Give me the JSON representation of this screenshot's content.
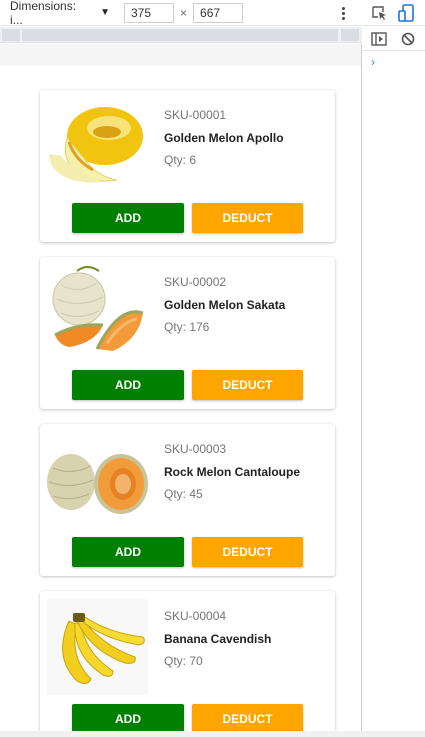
{
  "devtools": {
    "dimensions_label": "Dimensions: i...",
    "width_value": "375",
    "height_value": "667",
    "times_sign": "×"
  },
  "products": [
    {
      "sku": "SKU-00001",
      "name": "Golden Melon Apollo",
      "qty": "Qty: 6",
      "image": "golden-melon-image"
    },
    {
      "sku": "SKU-00002",
      "name": "Golden Melon Sakata",
      "qty": "Qty: 176",
      "image": "cantaloupe-slices-image"
    },
    {
      "sku": "SKU-00003",
      "name": "Rock Melon Cantaloupe",
      "qty": "Qty: 45",
      "image": "rock-melon-image"
    },
    {
      "sku": "SKU-00004",
      "name": "Banana Cavendish",
      "qty": "Qty: 70",
      "image": "banana-image"
    }
  ],
  "buttons": {
    "add": "ADD",
    "deduct": "DEDUCT"
  },
  "colors": {
    "add": "#008000",
    "deduct": "#ffa500"
  },
  "side_icons": [
    "inspect-element-icon",
    "device-toggle-icon",
    "console-sidebar-icon",
    "clear-console-icon"
  ],
  "console_prompt": "›"
}
